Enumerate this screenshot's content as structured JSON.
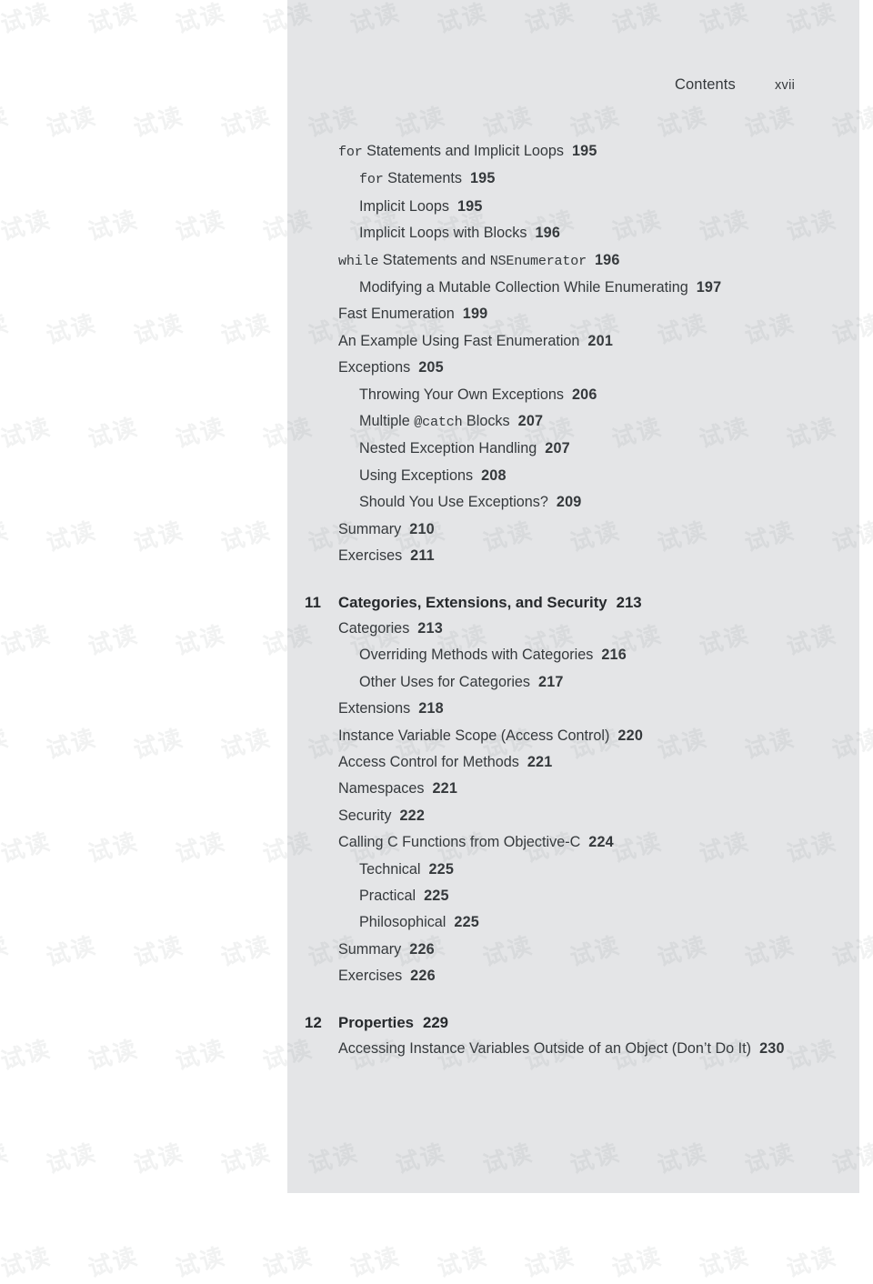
{
  "page": {
    "background_color": "#ffffff",
    "sheet_color": "#e4e5e7",
    "text_color": "#35393c",
    "watermark_text": "试读"
  },
  "running_head": {
    "title": "Contents",
    "folio": "xvii"
  },
  "toc": {
    "entries": [
      {
        "level": 1,
        "kind": "entry",
        "parts": [
          {
            "type": "mono",
            "text": "for"
          },
          {
            "type": "text",
            "text": " Statements and Implicit Loops"
          }
        ],
        "page": "195"
      },
      {
        "level": 2,
        "kind": "entry",
        "parts": [
          {
            "type": "mono",
            "text": "for"
          },
          {
            "type": "text",
            "text": " Statements"
          }
        ],
        "page": "195"
      },
      {
        "level": 2,
        "kind": "entry",
        "parts": [
          {
            "type": "text",
            "text": "Implicit Loops"
          }
        ],
        "page": "195"
      },
      {
        "level": 2,
        "kind": "entry",
        "parts": [
          {
            "type": "text",
            "text": "Implicit Loops with Blocks"
          }
        ],
        "page": "196"
      },
      {
        "level": 1,
        "kind": "entry",
        "parts": [
          {
            "type": "mono",
            "text": "while"
          },
          {
            "type": "text",
            "text": " Statements and "
          },
          {
            "type": "mono",
            "text": "NSEnumerator"
          }
        ],
        "page": "196"
      },
      {
        "level": 2,
        "kind": "entry",
        "wrap": true,
        "parts": [
          {
            "type": "text",
            "text": "Modifying a Mutable Collection While Enumerating"
          }
        ],
        "page": "197"
      },
      {
        "level": 1,
        "kind": "entry",
        "parts": [
          {
            "type": "text",
            "text": "Fast Enumeration"
          }
        ],
        "page": "199"
      },
      {
        "level": 1,
        "kind": "entry",
        "parts": [
          {
            "type": "text",
            "text": "An Example Using Fast Enumeration"
          }
        ],
        "page": "201"
      },
      {
        "level": 1,
        "kind": "entry",
        "parts": [
          {
            "type": "text",
            "text": "Exceptions"
          }
        ],
        "page": "205"
      },
      {
        "level": 2,
        "kind": "entry",
        "parts": [
          {
            "type": "text",
            "text": "Throwing Your Own Exceptions"
          }
        ],
        "page": "206"
      },
      {
        "level": 2,
        "kind": "entry",
        "parts": [
          {
            "type": "text",
            "text": "Multiple "
          },
          {
            "type": "mono",
            "text": "@catch"
          },
          {
            "type": "text",
            "text": " Blocks"
          }
        ],
        "page": "207"
      },
      {
        "level": 2,
        "kind": "entry",
        "parts": [
          {
            "type": "text",
            "text": "Nested Exception Handling"
          }
        ],
        "page": "207"
      },
      {
        "level": 2,
        "kind": "entry",
        "parts": [
          {
            "type": "text",
            "text": "Using Exceptions"
          }
        ],
        "page": "208"
      },
      {
        "level": 2,
        "kind": "entry",
        "parts": [
          {
            "type": "text",
            "text": "Should You Use Exceptions?"
          }
        ],
        "page": "209"
      },
      {
        "level": 1,
        "kind": "entry",
        "parts": [
          {
            "type": "text",
            "text": "Summary"
          }
        ],
        "page": "210"
      },
      {
        "level": 1,
        "kind": "entry",
        "parts": [
          {
            "type": "text",
            "text": "Exercises"
          }
        ],
        "page": "211"
      },
      {
        "level": 0,
        "kind": "chapter",
        "number": "11",
        "parts": [
          {
            "type": "text",
            "text": "Categories, Extensions, and Security"
          }
        ],
        "page": "213"
      },
      {
        "level": 1,
        "kind": "entry",
        "parts": [
          {
            "type": "text",
            "text": "Categories"
          }
        ],
        "page": "213"
      },
      {
        "level": 2,
        "kind": "entry",
        "parts": [
          {
            "type": "text",
            "text": "Overriding Methods with Categories"
          }
        ],
        "page": "216"
      },
      {
        "level": 2,
        "kind": "entry",
        "parts": [
          {
            "type": "text",
            "text": "Other Uses for Categories"
          }
        ],
        "page": "217"
      },
      {
        "level": 1,
        "kind": "entry",
        "parts": [
          {
            "type": "text",
            "text": "Extensions"
          }
        ],
        "page": "218"
      },
      {
        "level": 1,
        "kind": "entry",
        "parts": [
          {
            "type": "text",
            "text": "Instance Variable Scope (Access Control)"
          }
        ],
        "page": "220"
      },
      {
        "level": 1,
        "kind": "entry",
        "parts": [
          {
            "type": "text",
            "text": "Access Control for Methods"
          }
        ],
        "page": "221"
      },
      {
        "level": 1,
        "kind": "entry",
        "parts": [
          {
            "type": "text",
            "text": "Namespaces"
          }
        ],
        "page": "221"
      },
      {
        "level": 1,
        "kind": "entry",
        "parts": [
          {
            "type": "text",
            "text": "Security"
          }
        ],
        "page": "222"
      },
      {
        "level": 1,
        "kind": "entry",
        "parts": [
          {
            "type": "text",
            "text": "Calling C Functions from Objective-C"
          }
        ],
        "page": "224"
      },
      {
        "level": 2,
        "kind": "entry",
        "parts": [
          {
            "type": "text",
            "text": "Technical"
          }
        ],
        "page": "225"
      },
      {
        "level": 2,
        "kind": "entry",
        "parts": [
          {
            "type": "text",
            "text": "Practical"
          }
        ],
        "page": "225"
      },
      {
        "level": 2,
        "kind": "entry",
        "parts": [
          {
            "type": "text",
            "text": "Philosophical"
          }
        ],
        "page": "225"
      },
      {
        "level": 1,
        "kind": "entry",
        "parts": [
          {
            "type": "text",
            "text": "Summary"
          }
        ],
        "page": "226"
      },
      {
        "level": 1,
        "kind": "entry",
        "parts": [
          {
            "type": "text",
            "text": "Exercises"
          }
        ],
        "page": "226"
      },
      {
        "level": 0,
        "kind": "chapter",
        "number": "12",
        "parts": [
          {
            "type": "text",
            "text": "Properties"
          }
        ],
        "page": "229"
      },
      {
        "level": 1,
        "kind": "entry",
        "wrap": true,
        "parts": [
          {
            "type": "text",
            "text": "Accessing Instance Variables Outside of an Object (Don’t Do It)"
          }
        ],
        "page": "230"
      }
    ]
  }
}
